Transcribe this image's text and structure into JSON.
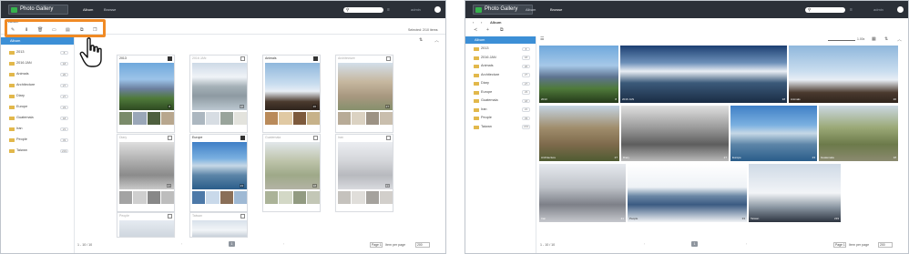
{
  "app": {
    "title": "Photo Gallery",
    "nav": [
      "Album",
      "Browse"
    ],
    "user": "admin"
  },
  "left": {
    "crumb": "Album",
    "selected_info": "Selected: 2/10 items",
    "tools": [
      "edit-icon",
      "download-icon",
      "delete-icon",
      "slideshow-icon",
      "move-icon",
      "copy-icon",
      "duplicate-icon"
    ],
    "side_head": "Album",
    "sidebar_items": [
      {
        "label": "2013",
        "count": "8"
      },
      {
        "label": "2016 JAN",
        "count": "18"
      },
      {
        "label": "Animals",
        "count": "20"
      },
      {
        "label": "Architecture",
        "count": "27"
      },
      {
        "label": "Diary",
        "count": "27"
      },
      {
        "label": "Europe",
        "count": "23"
      },
      {
        "label": "Guatemala",
        "count": "18"
      },
      {
        "label": "Iran",
        "count": "21"
      },
      {
        "label": "People",
        "count": "33"
      },
      {
        "label": "Taiwan",
        "count": "219"
      }
    ],
    "albums": [
      {
        "name": "2013",
        "checked": true,
        "count": "8"
      },
      {
        "name": "2016 JAN",
        "checked": false,
        "count": "18"
      },
      {
        "name": "Animals",
        "checked": true,
        "count": "20"
      },
      {
        "name": "Architecture",
        "checked": false,
        "count": "27"
      },
      {
        "name": "Diary",
        "checked": false,
        "count": "27"
      },
      {
        "name": "Europe",
        "checked": true,
        "count": "23"
      },
      {
        "name": "Guatemala",
        "checked": false,
        "count": "18"
      },
      {
        "name": "Iran",
        "checked": false,
        "count": "21"
      },
      {
        "name": "People",
        "checked": false,
        "count": "33"
      },
      {
        "name": "Taiwan",
        "checked": false,
        "count": "219"
      }
    ],
    "pager": {
      "range": "1 - 10 / 10",
      "page": "1",
      "page_select": "Page 1",
      "per_page_label": "Item per page",
      "per_page": "200"
    }
  },
  "right": {
    "crumb": "Album",
    "zoom": "1.00x",
    "side_head": "Album",
    "sidebar_items": [
      {
        "label": "2013",
        "count": "8"
      },
      {
        "label": "2016 JAN",
        "count": "18"
      },
      {
        "label": "Animals",
        "count": "20"
      },
      {
        "label": "Architecture",
        "count": "27"
      },
      {
        "label": "Diary",
        "count": "27"
      },
      {
        "label": "Europe",
        "count": "23"
      },
      {
        "label": "Guatemala",
        "count": "18"
      },
      {
        "label": "Iran",
        "count": "21"
      },
      {
        "label": "People",
        "count": "33"
      },
      {
        "label": "Taiwan",
        "count": "219"
      }
    ],
    "tiles": [
      {
        "name": "2013",
        "count": "8"
      },
      {
        "name": "2016 JAN",
        "count": "18"
      },
      {
        "name": "Animals",
        "count": "20"
      },
      {
        "name": "Architecture",
        "count": "27"
      },
      {
        "name": "Diary",
        "count": "27"
      },
      {
        "name": "Europe",
        "count": "23"
      },
      {
        "name": "Guatemala",
        "count": "18"
      },
      {
        "name": "Iran",
        "count": "21"
      },
      {
        "name": "People",
        "count": "33"
      },
      {
        "name": "Taiwan",
        "count": "219"
      }
    ],
    "pager": {
      "range": "1 - 10 / 10",
      "page": "1",
      "page_select": "Page 1",
      "per_page_label": "Item per page",
      "per_page": "200"
    }
  },
  "colors": {
    "topbar": "#2b3038",
    "accent": "#3c8fd6",
    "highlight": "#f08a24",
    "folder": "#e2b84b"
  }
}
